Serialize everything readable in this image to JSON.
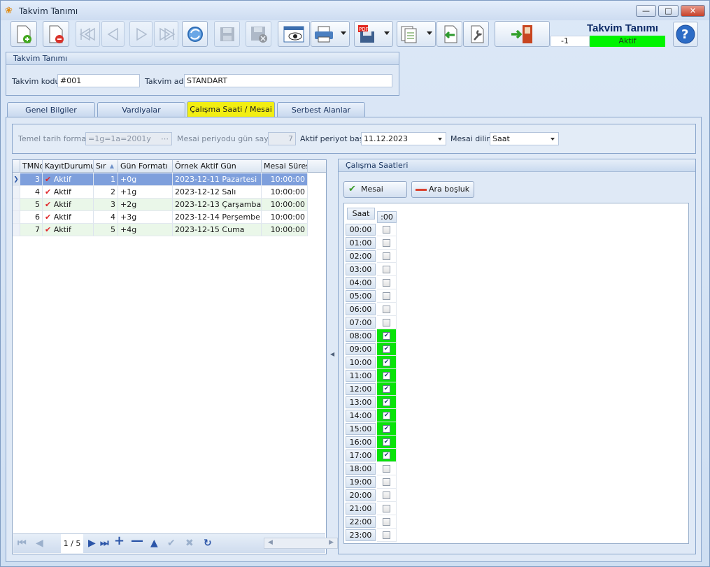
{
  "window": {
    "title": "Takvim Tanımı"
  },
  "header": {
    "title": "Takvim Tanımı",
    "record_no": "-1",
    "status": "Aktif"
  },
  "toolbar": [
    {
      "name": "new-record-button",
      "icon": "new-document-icon"
    },
    {
      "name": "delete-record-button",
      "icon": "delete-document-icon"
    },
    {
      "name": "first-record-button",
      "icon": "first-icon"
    },
    {
      "name": "previous-record-button",
      "icon": "previous-icon"
    },
    {
      "name": "next-record-button",
      "icon": "next-icon"
    },
    {
      "name": "last-record-button",
      "icon": "last-icon"
    },
    {
      "name": "refresh-button",
      "icon": "refresh-icon"
    },
    {
      "name": "save-button",
      "icon": "save-icon"
    },
    {
      "name": "cancel-save-button",
      "icon": "cancel-save-icon"
    },
    {
      "name": "preview-button",
      "icon": "preview-icon"
    },
    {
      "name": "print-button",
      "icon": "print-icon"
    },
    {
      "name": "pdf-export-button",
      "icon": "pdf-icon"
    },
    {
      "name": "import-button",
      "icon": "import-icon"
    },
    {
      "name": "back-button",
      "icon": "back-icon"
    },
    {
      "name": "tools-button",
      "icon": "wrench-icon"
    },
    {
      "name": "exit-button",
      "icon": "exit-door-icon"
    }
  ],
  "form": {
    "group_title": "Takvim Tanımı",
    "code_label": "Takvim kodu",
    "code_value": "#001",
    "name_label": "Takvim adı",
    "name_value": "STANDART"
  },
  "tabs": [
    {
      "label": "Genel Bilgiler",
      "active": false
    },
    {
      "label": "Vardiyalar",
      "active": false
    },
    {
      "label": "Çalışma Saati / Mesai",
      "active": true
    },
    {
      "label": "Serbest Alanlar",
      "active": false
    }
  ],
  "period": {
    "base_format_label": "Temel tarih formatı",
    "base_format_value": "=1g=1a=2001y",
    "days_label": "Mesai periyodu gün sayısı",
    "days_value": "7",
    "start_label": "Aktif periyot başı",
    "start_value": "11.12.2023",
    "unit_label": "Mesai dilim",
    "unit_value": "Saat"
  },
  "grid": {
    "columns": [
      "TMNo",
      "KayıtDurumu",
      "Sır",
      "Gün Formatı",
      "Örnek Aktif Gün",
      "Mesai Süresi"
    ],
    "rows": [
      {
        "tmno": "3",
        "status": "Aktif",
        "order": "1",
        "format": "+0g",
        "sample": "2023-12-11 Pazartesi",
        "duration": "10:00:00"
      },
      {
        "tmno": "4",
        "status": "Aktif",
        "order": "2",
        "format": "+1g",
        "sample": "2023-12-12 Salı",
        "duration": "10:00:00"
      },
      {
        "tmno": "5",
        "status": "Aktif",
        "order": "3",
        "format": "+2g",
        "sample": "2023-12-13 Çarşamba",
        "duration": "10:00:00"
      },
      {
        "tmno": "6",
        "status": "Aktif",
        "order": "4",
        "format": "+3g",
        "sample": "2023-12-14 Perşembe",
        "duration": "10:00:00"
      },
      {
        "tmno": "7",
        "status": "Aktif",
        "order": "5",
        "format": "+4g",
        "sample": "2023-12-15 Cuma",
        "duration": "10:00:00"
      }
    ],
    "pager": "1 / 5"
  },
  "hours_panel": {
    "title": "Çalışma Saatleri",
    "mesai_button": "Mesai",
    "break_button": "Ara boşluk",
    "hour_header": "Saat",
    "minute_header": ":00",
    "hours": [
      {
        "h": "00:00",
        "on": false
      },
      {
        "h": "01:00",
        "on": false
      },
      {
        "h": "02:00",
        "on": false
      },
      {
        "h": "03:00",
        "on": false
      },
      {
        "h": "04:00",
        "on": false
      },
      {
        "h": "05:00",
        "on": false
      },
      {
        "h": "06:00",
        "on": false
      },
      {
        "h": "07:00",
        "on": false
      },
      {
        "h": "08:00",
        "on": true
      },
      {
        "h": "09:00",
        "on": true
      },
      {
        "h": "10:00",
        "on": true
      },
      {
        "h": "11:00",
        "on": true
      },
      {
        "h": "12:00",
        "on": true
      },
      {
        "h": "13:00",
        "on": true
      },
      {
        "h": "14:00",
        "on": true
      },
      {
        "h": "15:00",
        "on": true
      },
      {
        "h": "16:00",
        "on": true
      },
      {
        "h": "17:00",
        "on": true
      },
      {
        "h": "18:00",
        "on": false
      },
      {
        "h": "19:00",
        "on": false
      },
      {
        "h": "20:00",
        "on": false
      },
      {
        "h": "21:00",
        "on": false
      },
      {
        "h": "22:00",
        "on": false
      },
      {
        "h": "23:00",
        "on": false
      }
    ]
  },
  "colors": {
    "accent_green": "#00f400",
    "hour_on": "#09e309",
    "active_tab": "#f2ee12",
    "title_blue": "#0c2a66",
    "selected_row": "#7e9fdc"
  }
}
